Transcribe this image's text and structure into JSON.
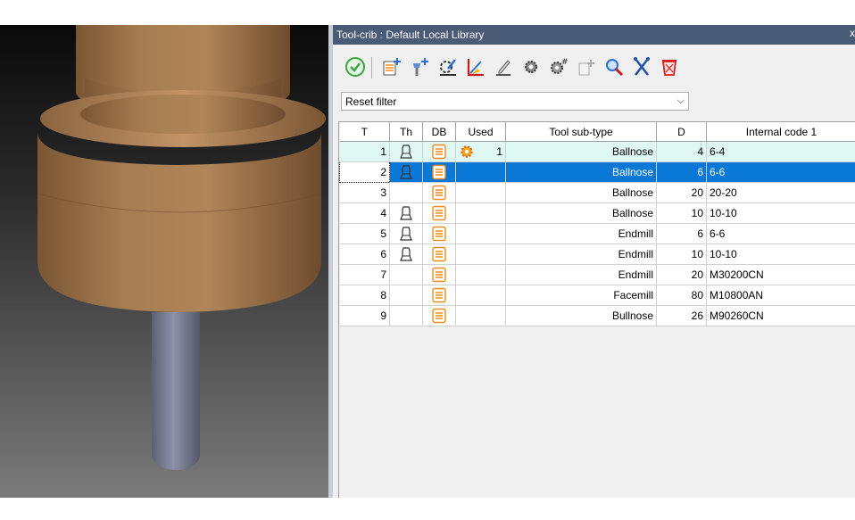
{
  "window": {
    "title": "Tool-crib : Default Local Library",
    "close_glyph": "x"
  },
  "toolbar": {
    "buttons": [
      {
        "name": "validate-icon"
      },
      {
        "name": "new-tool-icon"
      },
      {
        "name": "new-holder-icon"
      },
      {
        "name": "edit-tool-icon"
      },
      {
        "name": "measure-icon"
      },
      {
        "name": "rename-icon"
      },
      {
        "name": "gear-settings-icon"
      },
      {
        "name": "gear-number-icon"
      },
      {
        "name": "copy-tool-icon"
      },
      {
        "name": "search-tool-icon"
      },
      {
        "name": "cross-tools-icon"
      },
      {
        "name": "delete-icon"
      }
    ]
  },
  "filter": {
    "value": "Reset filter",
    "arrow": "⌵"
  },
  "table": {
    "columns": [
      "T",
      "Th",
      "DB",
      "Used",
      "Tool sub-type",
      "D",
      "Internal code 1"
    ],
    "rows": [
      {
        "t": "1",
        "th": true,
        "db": true,
        "used": "1",
        "subtype": "Ballnose",
        "d": "4",
        "code": "6-4",
        "state": "highlight"
      },
      {
        "t": "2",
        "th": true,
        "db": true,
        "used": "",
        "subtype": "Ballnose",
        "d": "6",
        "code": "6-6",
        "state": "selected"
      },
      {
        "t": "3",
        "th": false,
        "db": true,
        "used": "",
        "subtype": "Ballnose",
        "d": "20",
        "code": "20-20",
        "state": ""
      },
      {
        "t": "4",
        "th": true,
        "db": true,
        "used": "",
        "subtype": "Ballnose",
        "d": "10",
        "code": "10-10",
        "state": ""
      },
      {
        "t": "5",
        "th": true,
        "db": true,
        "used": "",
        "subtype": "Endmill",
        "d": "6",
        "code": "6-6",
        "state": ""
      },
      {
        "t": "6",
        "th": true,
        "db": true,
        "used": "",
        "subtype": "Endmill",
        "d": "10",
        "code": "10-10",
        "state": ""
      },
      {
        "t": "7",
        "th": false,
        "db": true,
        "used": "",
        "subtype": "Endmill",
        "d": "20",
        "code": "M30200CN",
        "state": ""
      },
      {
        "t": "8",
        "th": false,
        "db": true,
        "used": "",
        "subtype": "Facemill",
        "d": "80",
        "code": "M10800AN",
        "state": ""
      },
      {
        "t": "9",
        "th": false,
        "db": true,
        "used": "",
        "subtype": "Bullnose",
        "d": "26",
        "code": "M90260CN",
        "state": ""
      }
    ]
  },
  "colors": {
    "title_bar": "#4a5b78",
    "selection": "#0a78d7",
    "highlight": "#e0f8f4",
    "db_icon": "#f08a1c"
  }
}
